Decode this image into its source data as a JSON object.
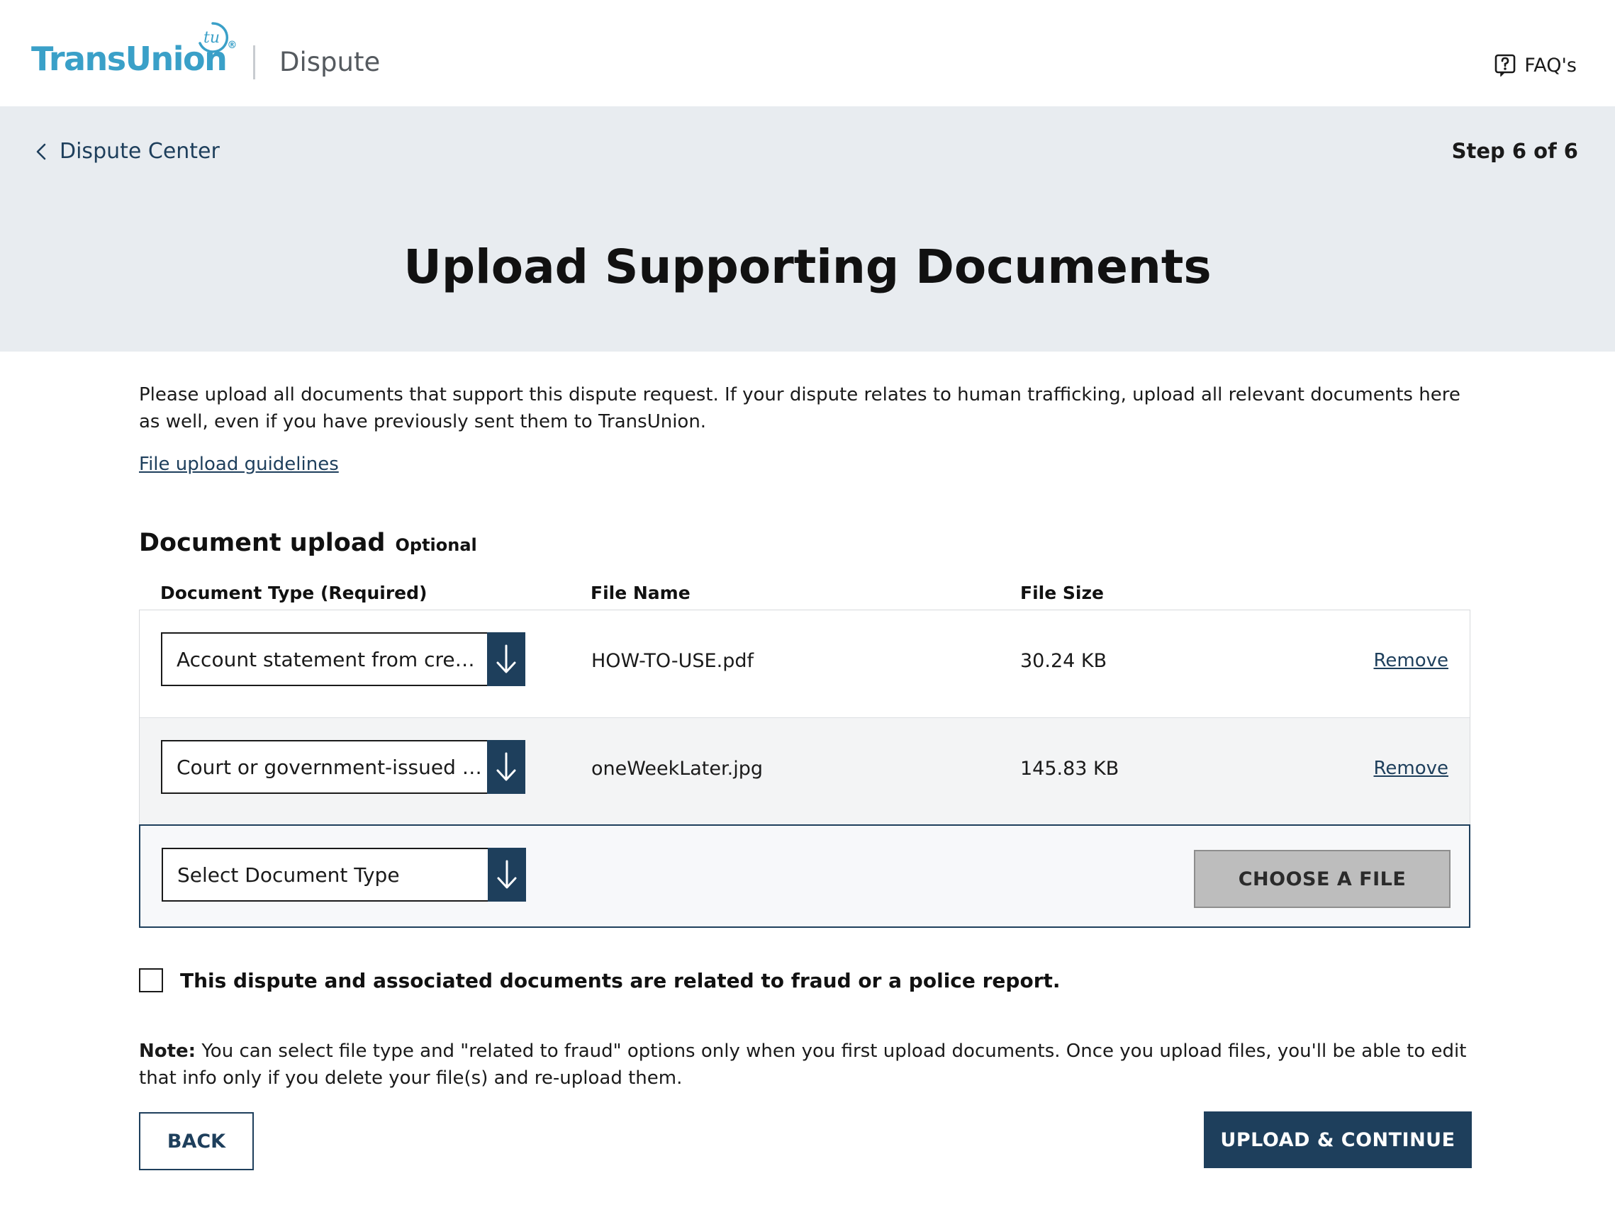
{
  "header": {
    "brand": "TransUnion",
    "brand_badge": "tu",
    "section": "Dispute",
    "faq_label": "FAQ's",
    "faq_icon": "help-square-icon"
  },
  "banner": {
    "back_label": "Dispute Center",
    "step": "Step 6 of 6",
    "title": "Upload Supporting Documents"
  },
  "intro": {
    "text": "Please upload all documents that support this dispute request. If your dispute relates to human trafficking, upload all relevant documents here as well, even if you have previously sent them to TransUnion.",
    "guidelines_link": "File upload guidelines"
  },
  "upload": {
    "title": "Document upload",
    "optional": "Optional",
    "columns": [
      "Document Type (Required)",
      "File Name",
      "File Size"
    ],
    "rows": [
      {
        "doc_type": "Account statement from creditor",
        "file_name": "HOW-TO-USE.pdf",
        "file_size": "30.24 KB",
        "remove": "Remove"
      },
      {
        "doc_type": "Court or government-issued document",
        "file_name": "oneWeekLater.jpg",
        "file_size": "145.83 KB",
        "remove": "Remove"
      }
    ],
    "new_row": {
      "placeholder": "Select Document Type",
      "choose_label": "CHOOSE A FILE"
    }
  },
  "fraud": {
    "label": "This dispute and associated documents are related to fraud or a police report."
  },
  "note": {
    "prefix": "Note:",
    "text": " You can select file type and \"related to fraud\" options only when you first upload documents. Once you upload files, you'll be able to edit that info only if you delete your file(s) and re-upload them."
  },
  "actions": {
    "back": "BACK",
    "continue": "UPLOAD & CONTINUE"
  },
  "colors": {
    "brand": "#3aa0c8",
    "navy": "#1e3f5c",
    "banner_bg": "#e8ecf0"
  }
}
